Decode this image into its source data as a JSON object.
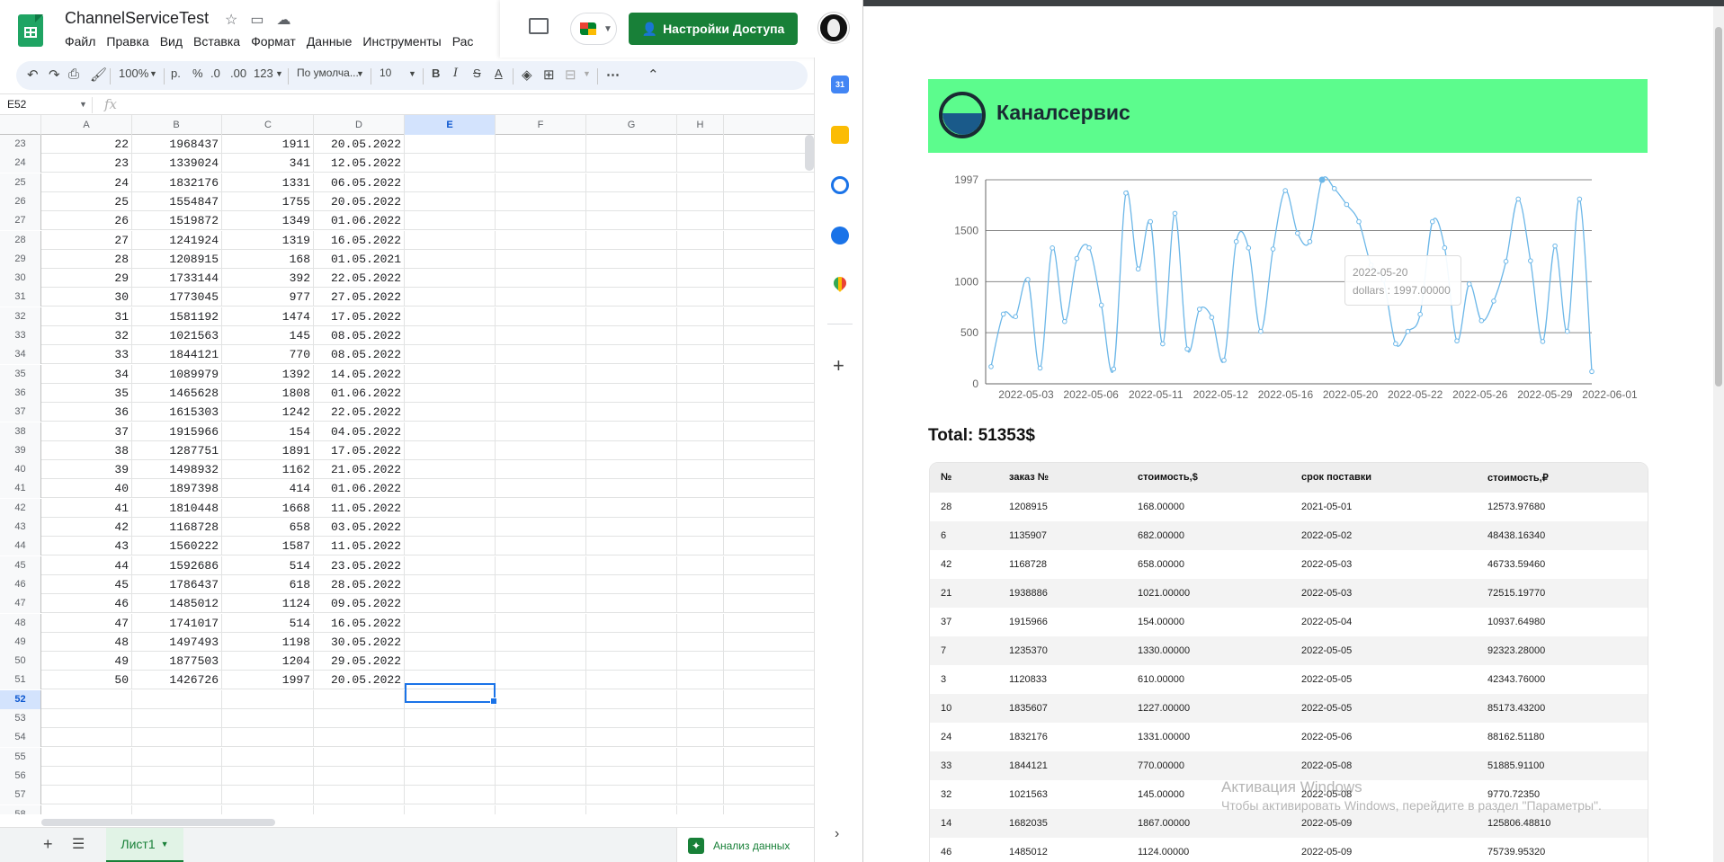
{
  "sheets": {
    "title": "ChannelServiceTest",
    "menu": [
      "Файл",
      "Правка",
      "Вид",
      "Вставка",
      "Формат",
      "Данные",
      "Инструменты",
      "Рас"
    ],
    "share_label": "Настройки Доступа",
    "toolbar": {
      "zoom": "100%",
      "currency": "р.",
      "percent": "%",
      "dec_less": ".0",
      "dec_more": ".00",
      "format_more": "123",
      "font": "По умолча...",
      "font_size": "10"
    },
    "name_box": "E52",
    "fx_label": "fx",
    "columns": [
      "A",
      "B",
      "C",
      "D",
      "E",
      "F",
      "G",
      "H"
    ],
    "selected_column": "E",
    "selected_row": "52",
    "rows": [
      {
        "n": "23",
        "a": "22",
        "b": "1968437",
        "c": "1911",
        "d": "20.05.2022"
      },
      {
        "n": "24",
        "a": "23",
        "b": "1339024",
        "c": "341",
        "d": "12.05.2022"
      },
      {
        "n": "25",
        "a": "24",
        "b": "1832176",
        "c": "1331",
        "d": "06.05.2022"
      },
      {
        "n": "26",
        "a": "25",
        "b": "1554847",
        "c": "1755",
        "d": "20.05.2022"
      },
      {
        "n": "27",
        "a": "26",
        "b": "1519872",
        "c": "1349",
        "d": "01.06.2022"
      },
      {
        "n": "28",
        "a": "27",
        "b": "1241924",
        "c": "1319",
        "d": "16.05.2022"
      },
      {
        "n": "29",
        "a": "28",
        "b": "1208915",
        "c": "168",
        "d": "01.05.2021"
      },
      {
        "n": "30",
        "a": "29",
        "b": "1733144",
        "c": "392",
        "d": "22.05.2022"
      },
      {
        "n": "31",
        "a": "30",
        "b": "1773045",
        "c": "977",
        "d": "27.05.2022"
      },
      {
        "n": "32",
        "a": "31",
        "b": "1581192",
        "c": "1474",
        "d": "17.05.2022"
      },
      {
        "n": "33",
        "a": "32",
        "b": "1021563",
        "c": "145",
        "d": "08.05.2022"
      },
      {
        "n": "34",
        "a": "33",
        "b": "1844121",
        "c": "770",
        "d": "08.05.2022"
      },
      {
        "n": "35",
        "a": "34",
        "b": "1089979",
        "c": "1392",
        "d": "14.05.2022"
      },
      {
        "n": "36",
        "a": "35",
        "b": "1465628",
        "c": "1808",
        "d": "01.06.2022"
      },
      {
        "n": "37",
        "a": "36",
        "b": "1615303",
        "c": "1242",
        "d": "22.05.2022"
      },
      {
        "n": "38",
        "a": "37",
        "b": "1915966",
        "c": "154",
        "d": "04.05.2022"
      },
      {
        "n": "39",
        "a": "38",
        "b": "1287751",
        "c": "1891",
        "d": "17.05.2022"
      },
      {
        "n": "40",
        "a": "39",
        "b": "1498932",
        "c": "1162",
        "d": "21.05.2022"
      },
      {
        "n": "41",
        "a": "40",
        "b": "1897398",
        "c": "414",
        "d": "01.06.2022"
      },
      {
        "n": "42",
        "a": "41",
        "b": "1810448",
        "c": "1668",
        "d": "11.05.2022"
      },
      {
        "n": "43",
        "a": "42",
        "b": "1168728",
        "c": "658",
        "d": "03.05.2022"
      },
      {
        "n": "44",
        "a": "43",
        "b": "1560222",
        "c": "1587",
        "d": "11.05.2022"
      },
      {
        "n": "45",
        "a": "44",
        "b": "1592686",
        "c": "514",
        "d": "23.05.2022"
      },
      {
        "n": "46",
        "a": "45",
        "b": "1786437",
        "c": "618",
        "d": "28.05.2022"
      },
      {
        "n": "47",
        "a": "46",
        "b": "1485012",
        "c": "1124",
        "d": "09.05.2022"
      },
      {
        "n": "48",
        "a": "47",
        "b": "1741017",
        "c": "514",
        "d": "16.05.2022"
      },
      {
        "n": "49",
        "a": "48",
        "b": "1497493",
        "c": "1198",
        "d": "30.05.2022"
      },
      {
        "n": "50",
        "a": "49",
        "b": "1877503",
        "c": "1204",
        "d": "29.05.2022"
      },
      {
        "n": "51",
        "a": "50",
        "b": "1426726",
        "c": "1997",
        "d": "20.05.2022"
      },
      {
        "n": "52",
        "a": "",
        "b": "",
        "c": "",
        "d": ""
      },
      {
        "n": "53",
        "a": "",
        "b": "",
        "c": "",
        "d": ""
      },
      {
        "n": "54",
        "a": "",
        "b": "",
        "c": "",
        "d": ""
      },
      {
        "n": "55",
        "a": "",
        "b": "",
        "c": "",
        "d": ""
      },
      {
        "n": "56",
        "a": "",
        "b": "",
        "c": "",
        "d": ""
      },
      {
        "n": "57",
        "a": "",
        "b": "",
        "c": "",
        "d": ""
      },
      {
        "n": "58",
        "a": "",
        "b": "",
        "c": "",
        "d": ""
      }
    ],
    "sheet_tab": "Лист1",
    "explore_label": "Анализ данных",
    "calendar_icon_text": "31"
  },
  "site": {
    "brand_name": "Каналсервис",
    "total": "Total: 51353$",
    "tooltip": {
      "date": "2022-05-20",
      "value": "dollars : 1997.00000"
    },
    "table": {
      "headers": [
        "№",
        "заказ №",
        "стоимость,$",
        "срок поставки",
        "стоимость,₽"
      ],
      "rows": [
        [
          "28",
          "1208915",
          "168.00000",
          "2021-05-01",
          "12573.97680"
        ],
        [
          "6",
          "1135907",
          "682.00000",
          "2022-05-02",
          "48438.16340"
        ],
        [
          "42",
          "1168728",
          "658.00000",
          "2022-05-03",
          "46733.59460"
        ],
        [
          "21",
          "1938886",
          "1021.00000",
          "2022-05-03",
          "72515.19770"
        ],
        [
          "37",
          "1915966",
          "154.00000",
          "2022-05-04",
          "10937.64980"
        ],
        [
          "7",
          "1235370",
          "1330.00000",
          "2022-05-05",
          "92323.28000"
        ],
        [
          "3",
          "1120833",
          "610.00000",
          "2022-05-05",
          "42343.76000"
        ],
        [
          "10",
          "1835607",
          "1227.00000",
          "2022-05-05",
          "85173.43200"
        ],
        [
          "24",
          "1832176",
          "1331.00000",
          "2022-05-06",
          "88162.51180"
        ],
        [
          "33",
          "1844121",
          "770.00000",
          "2022-05-08",
          "51885.91100"
        ],
        [
          "32",
          "1021563",
          "145.00000",
          "2022-05-08",
          "9770.72350"
        ],
        [
          "14",
          "1682035",
          "1867.00000",
          "2022-05-09",
          "125806.48810"
        ],
        [
          "46",
          "1485012",
          "1124.00000",
          "2022-05-09",
          "75739.95320"
        ]
      ]
    },
    "watermark": {
      "line1": "Активация Windows",
      "line2": "Чтобы активировать Windows, перейдите в раздел \"Параметры\"."
    }
  },
  "chart_data": {
    "type": "line",
    "title": "",
    "xlabel": "",
    "ylabel": "",
    "ylim": [
      0,
      1997
    ],
    "y_ticks": [
      0,
      500,
      1000,
      1500,
      1997
    ],
    "x_tick_labels": [
      "2022-05-03",
      "2022-05-06",
      "2022-05-11",
      "2022-05-12",
      "2022-05-16",
      "2022-05-20",
      "2022-05-22",
      "2022-05-26",
      "2022-05-29",
      "2022-06-01"
    ],
    "grid": true,
    "color": "#6cb7e8",
    "values": [
      168,
      682,
      658,
      1021,
      154,
      1330,
      610,
      1227,
      1331,
      770,
      145,
      1867,
      1124,
      1587,
      391,
      1668,
      341,
      730,
      650,
      230,
      1392,
      1330,
      514,
      1319,
      1891,
      1474,
      1392,
      1997,
      1911,
      1755,
      1587,
      1162,
      1021,
      392,
      514,
      680,
      1587,
      1331,
      420,
      977,
      618,
      810,
      1198,
      1808,
      1204,
      414,
      1349,
      514,
      1808,
      120
    ]
  }
}
